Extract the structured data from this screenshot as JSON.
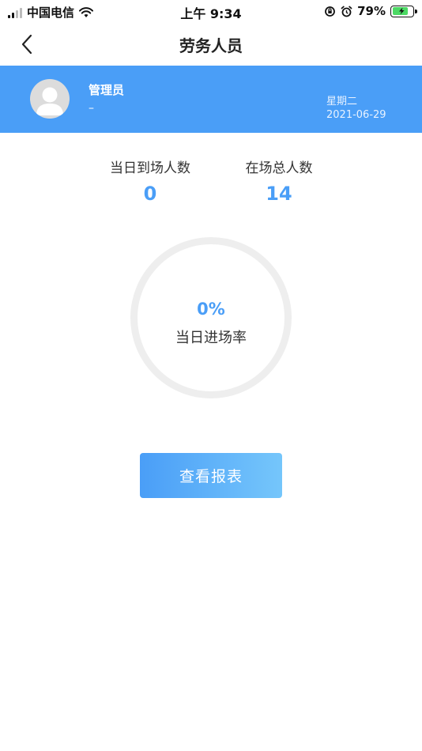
{
  "status_bar": {
    "carrier": "中国电信",
    "time": "上午 9:34",
    "battery": "79%"
  },
  "nav": {
    "title": "劳务人员",
    "back_icon": "chevron-left-icon"
  },
  "user": {
    "name": "管理员",
    "subtitle": "–",
    "weekday": "星期二",
    "date": "2021-06-29"
  },
  "stats": {
    "today_arrivals": {
      "label": "当日到场人数",
      "value": "0"
    },
    "total_on_site": {
      "label": "在场总人数",
      "value": "14"
    }
  },
  "entry_rate": {
    "value": "0%",
    "label": "当日进场率"
  },
  "report_button": {
    "label": "查看报表"
  },
  "colors": {
    "accent": "#4a9ef7",
    "ring_track": "#eeeeee"
  }
}
